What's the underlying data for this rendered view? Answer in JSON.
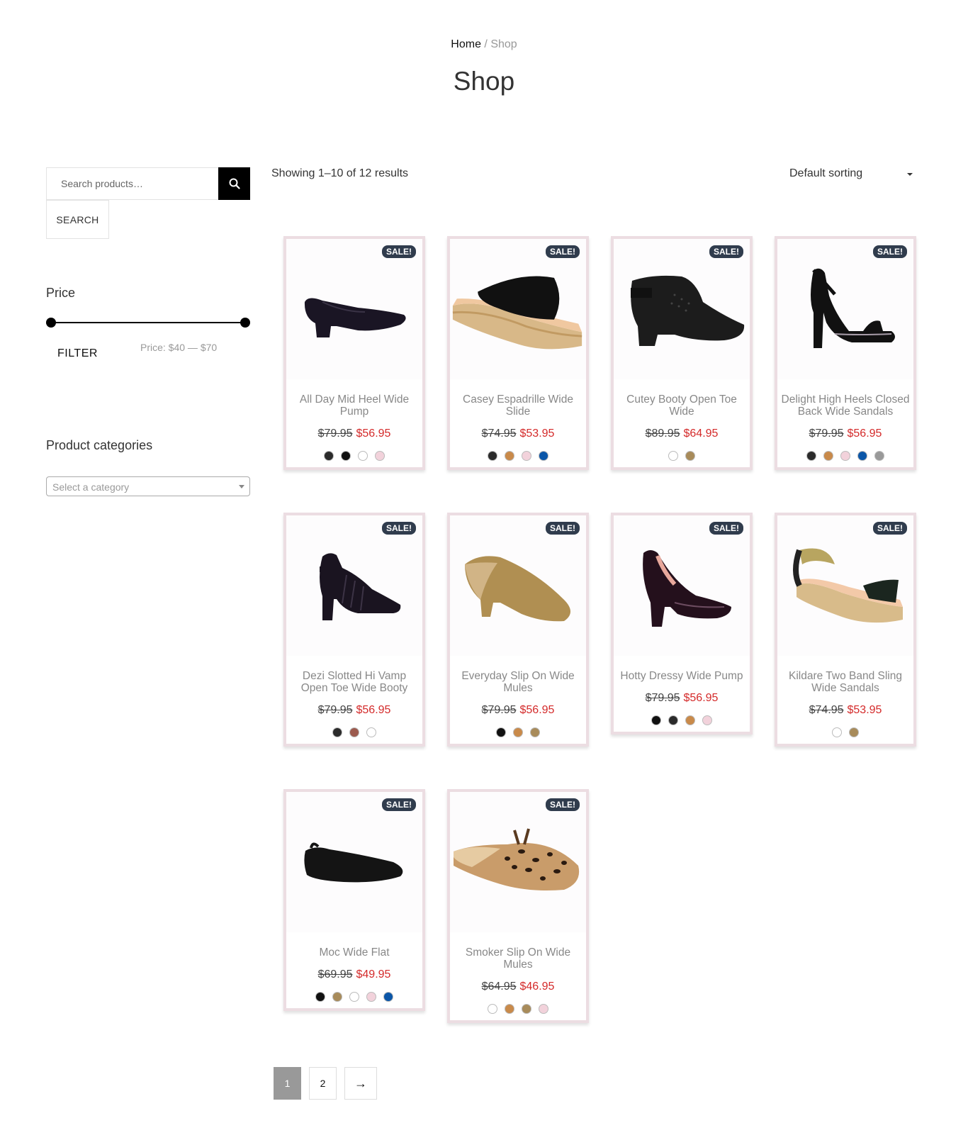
{
  "breadcrumb": {
    "home": "Home",
    "separator": " / ",
    "current": "Shop"
  },
  "page_title": "Shop",
  "sidebar": {
    "search_placeholder": "Search products…",
    "search_button": "SEARCH",
    "price_title": "Price",
    "filter_button": "FILTER",
    "price_range": "Price: $40 — $70",
    "categories_title": "Product categories",
    "category_select": "Select a category"
  },
  "toolbar": {
    "results": "Showing 1–10 of 12 results",
    "sorting": "Default sorting"
  },
  "sale_badge": "SALE!",
  "products": [
    {
      "name": "All Day Mid Heel Wide Pump",
      "old_price": "$79.95",
      "new_price": "$56.95",
      "swatches": [
        "#2b2b2b",
        "#111111",
        "#ffffff",
        "#f2d2db"
      ]
    },
    {
      "name": "Casey Espadrille Wide Slide",
      "old_price": "$74.95",
      "new_price": "$53.95",
      "swatches": [
        "#2b2b2b",
        "#c98a4a",
        "#f2d2db",
        "#0b56a8"
      ]
    },
    {
      "name": "Cutey Booty Open Toe Wide",
      "old_price": "$89.95",
      "new_price": "$64.95",
      "swatches": [
        "#ffffff",
        "#a88b5a"
      ]
    },
    {
      "name": "Delight High Heels Closed Back Wide Sandals",
      "old_price": "$79.95",
      "new_price": "$56.95",
      "swatches": [
        "#2b2b2b",
        "#c98a4a",
        "#f2d2db",
        "#0b56a8",
        "#999999"
      ]
    },
    {
      "name": "Dezi Slotted Hi Vamp Open Toe Wide Booty",
      "old_price": "$79.95",
      "new_price": "$56.95",
      "swatches": [
        "#2b2b2b",
        "#9c5a4e",
        "#ffffff"
      ]
    },
    {
      "name": "Everyday Slip On Wide Mules",
      "old_price": "$79.95",
      "new_price": "$56.95",
      "swatches": [
        "#111111",
        "#c98a4a",
        "#a88b5a"
      ]
    },
    {
      "name": "Hotty Dressy Wide Pump",
      "old_price": "$79.95",
      "new_price": "$56.95",
      "swatches": [
        "#111111",
        "#2b2b2b",
        "#c98a4a",
        "#f2d2db"
      ]
    },
    {
      "name": "Kildare Two Band Sling Wide Sandals",
      "old_price": "$74.95",
      "new_price": "$53.95",
      "swatches": [
        "#ffffff",
        "#a88b5a"
      ]
    },
    {
      "name": "Moc Wide Flat",
      "old_price": "$69.95",
      "new_price": "$49.95",
      "swatches": [
        "#111111",
        "#a88b5a",
        "#ffffff",
        "#f2d2db",
        "#0b56a8"
      ]
    },
    {
      "name": "Smoker Slip On Wide Mules",
      "old_price": "$64.95",
      "new_price": "$46.95",
      "swatches": [
        "#ffffff",
        "#c98a4a",
        "#a88b5a",
        "#f2d2db"
      ]
    }
  ],
  "pagination": {
    "page1": "1",
    "page2": "2",
    "next": "→"
  }
}
